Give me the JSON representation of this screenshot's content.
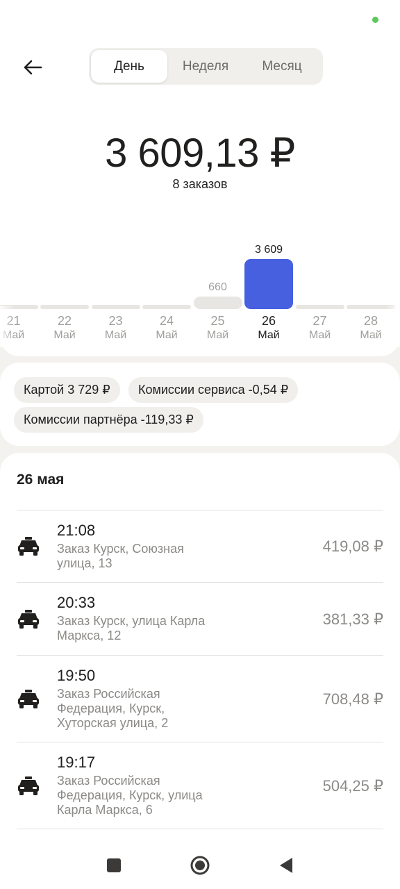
{
  "header": {
    "back_icon": "arrow-left-icon",
    "tabs": [
      {
        "label": "День",
        "active": true
      },
      {
        "label": "Неделя",
        "active": false
      },
      {
        "label": "Месяц",
        "active": false
      }
    ]
  },
  "summary": {
    "total": "3 609,13 ₽",
    "orders": "8 заказов"
  },
  "chart_data": {
    "type": "bar",
    "categories": [
      "21 Май",
      "22 Май",
      "23 Май",
      "24 Май",
      "25 Май",
      "26 Май",
      "27 Май",
      "28 Май"
    ],
    "days": [
      {
        "num": "21",
        "month": "Май",
        "value": 0,
        "label": ""
      },
      {
        "num": "22",
        "month": "Май",
        "value": 0,
        "label": ""
      },
      {
        "num": "23",
        "month": "Май",
        "value": 0,
        "label": ""
      },
      {
        "num": "24",
        "month": "Май",
        "value": 0,
        "label": ""
      },
      {
        "num": "25",
        "month": "Май",
        "value": 660,
        "label": "660"
      },
      {
        "num": "26",
        "month": "Май",
        "value": 3609,
        "label": "3 609"
      },
      {
        "num": "27",
        "month": "Май",
        "value": 0,
        "label": ""
      },
      {
        "num": "28",
        "month": "Май",
        "value": 0,
        "label": ""
      }
    ],
    "values": [
      0,
      0,
      0,
      0,
      660,
      3609,
      0,
      0
    ],
    "selected_index": 5,
    "colors": {
      "selected": "#4660e0",
      "normal": "#e8e6e2"
    }
  },
  "chips": {
    "card": "Картой 3 729 ₽",
    "service_fee": "Комиссии сервиса -0,54 ₽",
    "partner_fee": "Комиссии партнёра -119,33 ₽"
  },
  "orders": {
    "date": "26 мая",
    "icon": "taxi-car-icon",
    "items": [
      {
        "time": "21:08",
        "address": "Заказ Курск, Союзная улица, 13",
        "price": "419,08 ₽"
      },
      {
        "time": "20:33",
        "address": "Заказ Курск, улица Карла Маркса, 12",
        "price": "381,33 ₽"
      },
      {
        "time": "19:50",
        "address": "Заказ Российская Федерация, Курск, Хуторская улица, 2",
        "price": "708,48 ₽"
      },
      {
        "time": "19:17",
        "address": "Заказ Российская Федерация, Курск, улица Карла Маркса, 6",
        "price": "504,25 ₽"
      }
    ]
  },
  "navbar": {
    "items": [
      "recents-square-icon",
      "home-circle-icon",
      "back-triangle-icon"
    ]
  }
}
